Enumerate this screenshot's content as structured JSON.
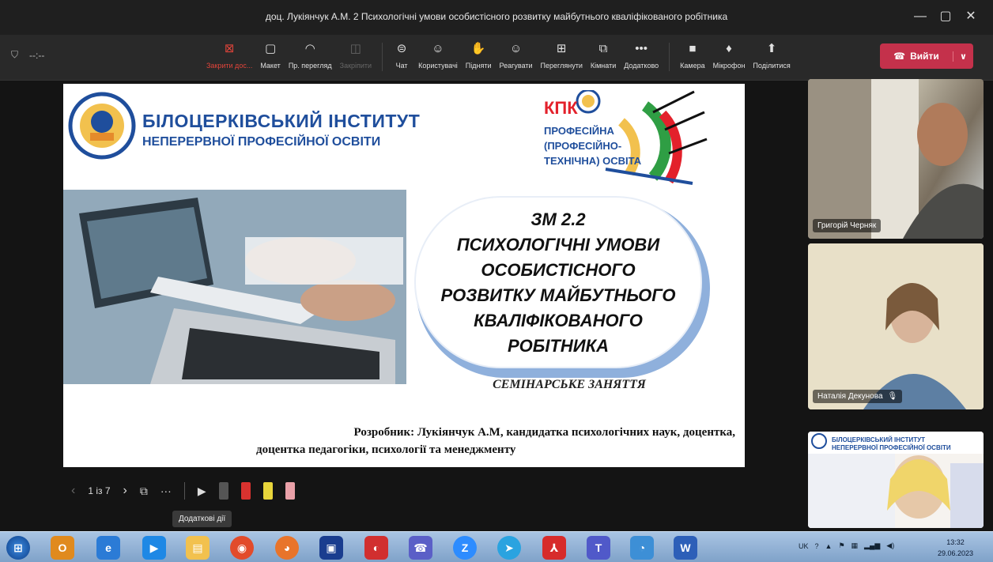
{
  "window": {
    "title": "доц. Лукіянчук А.М. 2 Психологічні умови особистісного розвитку майбутнього кваліфікованого робітника"
  },
  "toolbar": {
    "timer": "--:--",
    "items": [
      {
        "label": "Закрити дос...",
        "icon": "close-share-icon",
        "glyph": "⊠",
        "state": "red"
      },
      {
        "label": "Макет",
        "icon": "layout-icon",
        "glyph": "▢",
        "state": ""
      },
      {
        "label": "Пр. перегляд",
        "icon": "eye-icon",
        "glyph": "◠",
        "state": ""
      },
      {
        "label": "Закріпити",
        "icon": "pin-icon",
        "glyph": "◫",
        "state": "dim"
      },
      {
        "label": "Чат",
        "icon": "chat-icon",
        "glyph": "⊜",
        "state": ""
      },
      {
        "label": "Користувачі",
        "icon": "people-icon",
        "glyph": "☺",
        "state": ""
      },
      {
        "label": "Підняти",
        "icon": "hand-icon",
        "glyph": "✋",
        "state": ""
      },
      {
        "label": "Реагувати",
        "icon": "react-icon",
        "glyph": "☺",
        "state": ""
      },
      {
        "label": "Переглянути",
        "icon": "view-icon",
        "glyph": "⊞",
        "state": ""
      },
      {
        "label": "Кімнати",
        "icon": "rooms-icon",
        "glyph": "⧉",
        "state": ""
      },
      {
        "label": "Додатково",
        "icon": "more-icon",
        "glyph": "•••",
        "state": ""
      },
      {
        "label": "Камера",
        "icon": "camera-icon",
        "glyph": "■",
        "state": ""
      },
      {
        "label": "Мікрофон",
        "icon": "mic-icon",
        "glyph": "♦",
        "state": ""
      },
      {
        "label": "Поділитися",
        "icon": "share-icon",
        "glyph": "⬆",
        "state": ""
      }
    ],
    "leave_label": "Вийти"
  },
  "slide": {
    "institute_line1": "БІЛОЦЕРКІВСЬКИЙ ІНСТИТУТ",
    "institute_line2": "НЕПЕРЕРВНОЇ ПРОФЕСІЙНОЇ ОСВІТИ",
    "kpk_title": "КПК",
    "kpk_sub1": "ПРОФЕСІЙНА",
    "kpk_sub2": "(ПРОФЕСІЙНО-",
    "kpk_sub3": "ТЕХНІЧНА) ОСВІТА",
    "topic_lines": [
      "ЗМ 2.2",
      "ПСИХОЛОГІЧНІ УМОВИ",
      "ОСОБИСТІСНОГО",
      "РОЗВИТКУ МАЙБУТНЬОГО",
      "КВАЛІФІКОВАНОГО",
      "РОБІТНИКА"
    ],
    "seminar": "СЕМІНАРСЬКЕ ЗАНЯТТЯ",
    "author_line1": "Розробник: Лукіянчук А.М, кандидатка психологічних наук, доцентка,",
    "author_line2": "доцентка педагогіки, психології та менеджменту"
  },
  "participants": [
    {
      "name": "Григорій Черняк"
    },
    {
      "name": "Наталія Декунова"
    }
  ],
  "preview_tile": {
    "line1": "БІЛОЦЕРКІВСЬКИЙ ІНСТИТУТ",
    "line2": "НЕПЕРЕРВНОЇ ПРОФЕСІЙНОЇ ОСВІТИ"
  },
  "controls": {
    "page": "1 із 7",
    "tooltip": "Додаткові дії"
  },
  "taskbar": {
    "lang": "UK",
    "time": "13:32",
    "date": "29.06.2023"
  }
}
